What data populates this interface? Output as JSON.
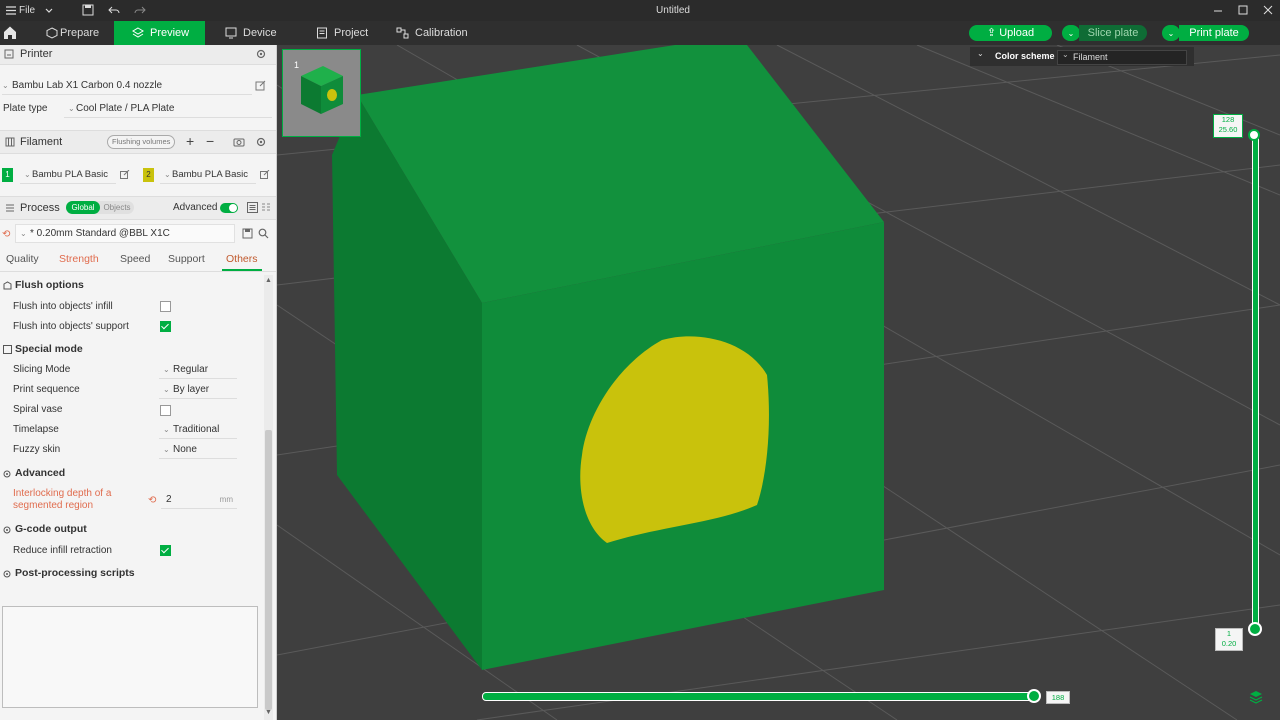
{
  "window": {
    "menu_label": "File",
    "title": "Untitled"
  },
  "toolbar": {
    "tabs": [
      {
        "label": "Prepare",
        "active": false
      },
      {
        "label": "Preview",
        "active": true
      },
      {
        "label": "Device",
        "active": false
      },
      {
        "label": "Project",
        "active": false
      },
      {
        "label": "Calibration",
        "active": false
      }
    ],
    "upload_label": "Upload",
    "slice_label": "Slice plate",
    "print_label": "Print plate"
  },
  "printer": {
    "section_label": "Printer",
    "name": "Bambu Lab X1 Carbon 0.4 nozzle",
    "plate_type_label": "Plate type",
    "plate_type_value": "Cool Plate / PLA Plate"
  },
  "filament": {
    "section_label": "Filament",
    "flushing_label": "Flushing volumes",
    "slots": [
      {
        "num": "1",
        "name": "Bambu PLA Basic",
        "color": "#00ae42"
      },
      {
        "num": "2",
        "name": "Bambu PLA Basic",
        "color": "#c9c20c"
      }
    ]
  },
  "process": {
    "section_label": "Process",
    "global_label": "Global",
    "objects_label": "Objects",
    "advanced_label": "Advanced",
    "preset": "* 0.20mm Standard @BBL X1C",
    "tabs": [
      "Quality",
      "Strength",
      "Speed",
      "Support",
      "Others"
    ],
    "active_tab": "Others"
  },
  "others": {
    "flush_title": "Flush options",
    "flush_infill_label": "Flush into objects' infill",
    "flush_infill_checked": false,
    "flush_support_label": "Flush into objects' support",
    "flush_support_checked": true,
    "special_title": "Special mode",
    "slicing_mode_label": "Slicing Mode",
    "slicing_mode_value": "Regular",
    "print_sequence_label": "Print sequence",
    "print_sequence_value": "By layer",
    "spiral_label": "Spiral vase",
    "spiral_checked": false,
    "timelapse_label": "Timelapse",
    "timelapse_value": "Traditional",
    "fuzzy_label": "Fuzzy skin",
    "fuzzy_value": "None",
    "advanced_title": "Advanced",
    "interlock_label_1": "Interlocking depth of a",
    "interlock_label_2": "segmented region",
    "interlock_value": "2",
    "interlock_unit": "mm",
    "gcode_title": "G-code output",
    "reduce_label": "Reduce infill retraction",
    "reduce_checked": true,
    "post_title": "Post-processing scripts"
  },
  "viewport": {
    "plate_number": "1",
    "color_scheme_label": "Color scheme",
    "color_scheme_value": "Filament",
    "layer_top_index": "128",
    "layer_top_height": "25.60",
    "layer_bottom_index": "1",
    "layer_bottom_height": "0.20",
    "moves_value": "188",
    "colors": {
      "accent": "#00ae42",
      "model_green": "#0f8c3a",
      "model_yellow": "#c9c20c"
    }
  }
}
